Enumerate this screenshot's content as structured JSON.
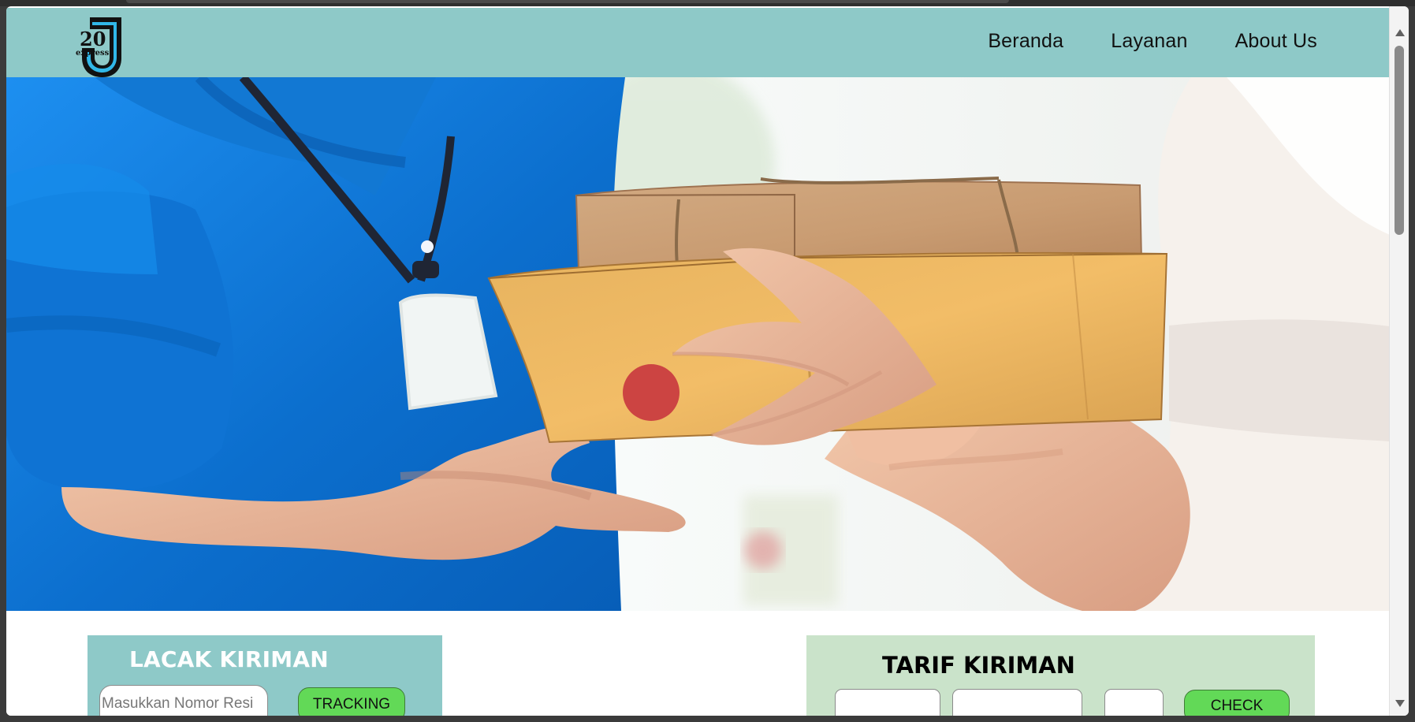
{
  "brand": {
    "logo_number": "20",
    "logo_subtitle": "express",
    "logo_letter": "J"
  },
  "nav": {
    "items": [
      {
        "label": "Beranda"
      },
      {
        "label": "Layanan"
      },
      {
        "label": "About Us"
      }
    ]
  },
  "tracking": {
    "title": "LACAK KIRIMAN",
    "input_placeholder": "Masukkan Nomor Resi",
    "button_label": "TRACKING"
  },
  "rates": {
    "title": "TARIF KIRIMAN",
    "origin_value": "",
    "destination_value": "",
    "weight_value": "",
    "button_label": "CHECK"
  },
  "colors": {
    "header_background": "#8ec9c8",
    "tracking_panel": "#8ec9c8",
    "rates_panel": "#cae3ca",
    "button_green": "#62d957",
    "courier_blue": "#0e78d6"
  },
  "icons": {
    "scroll_up": "chevron-up-icon",
    "scroll_down": "chevron-down-icon",
    "logo": "express-logo-icon"
  }
}
